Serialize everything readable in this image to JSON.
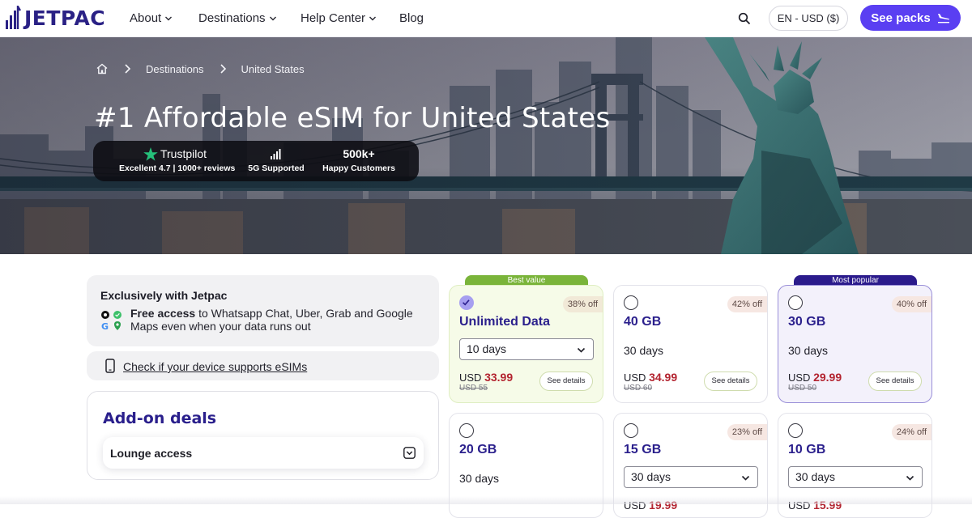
{
  "nav": {
    "logo_text": "JETPAC",
    "items": [
      {
        "label": "About",
        "has_menu": true
      },
      {
        "label": "Destinations",
        "has_menu": true
      },
      {
        "label": "Help Center",
        "has_menu": true
      },
      {
        "label": "Blog",
        "has_menu": false
      }
    ],
    "search_icon": "search-icon",
    "language_label": "EN - USD ($)",
    "cta_label": "See packs",
    "cta_icon": "plane-landing-icon",
    "accent_color": "#5a3ff2",
    "brand_color": "#2a2185"
  },
  "breadcrumb": {
    "home_icon": "home-icon",
    "items": [
      "Destinations",
      "United States"
    ]
  },
  "hero": {
    "title": "#1 Affordable eSIM for United States",
    "stats": [
      {
        "top": "Trustpilot",
        "icon": "trustpilot-star-icon",
        "bottom": "Excellent 4.7 | 1000+ reviews"
      },
      {
        "top": "",
        "icon": "signal-bars-icon",
        "bottom": "5G Supported"
      },
      {
        "top": "500k+",
        "icon": "",
        "bottom": "Happy Customers"
      }
    ]
  },
  "exclusive": {
    "title": "Exclusively with Jetpac",
    "bold": "Free access",
    "text": " to Whatsapp Chat, Uber, Grab and Google Maps even when your data runs out"
  },
  "device_check": {
    "label": "Check if your device supports eSIMs",
    "icon": "phone-icon"
  },
  "addons": {
    "title": "Add-on deals",
    "items": [
      {
        "label": "Lounge access",
        "icon": "chevron-down-square-icon"
      }
    ]
  },
  "packs": [
    {
      "ribbon": "Best value",
      "checked": true,
      "discount": "38% off",
      "title": "Unlimited Data",
      "duration": "10 days",
      "duration_is_select": true,
      "currency": "USD",
      "price": "33.99",
      "old_price": "USD 55",
      "details_label": "See details"
    },
    {
      "ribbon": "",
      "checked": false,
      "discount": "42% off",
      "title": "40 GB",
      "duration": "30 days",
      "duration_is_select": false,
      "currency": "USD",
      "price": "34.99",
      "old_price": "USD 60",
      "details_label": "See details"
    },
    {
      "ribbon": "Most popular",
      "checked": false,
      "discount": "40% off",
      "title": "30 GB",
      "duration": "30 days",
      "duration_is_select": false,
      "currency": "USD",
      "price": "29.99",
      "old_price": "USD 50",
      "details_label": "See details"
    },
    {
      "ribbon": "",
      "checked": false,
      "discount": "",
      "title": "20 GB",
      "duration": "30 days",
      "duration_is_select": false,
      "currency": "",
      "price": "",
      "old_price": "",
      "details_label": ""
    },
    {
      "ribbon": "",
      "checked": false,
      "discount": "23% off",
      "title": "15 GB",
      "duration": "30 days",
      "duration_is_select": true,
      "currency": "USD",
      "price": "19.99",
      "old_price": "",
      "details_label": ""
    },
    {
      "ribbon": "",
      "checked": false,
      "discount": "24% off",
      "title": "10 GB",
      "duration": "30 days",
      "duration_is_select": true,
      "currency": "USD",
      "price": "15.99",
      "old_price": "",
      "details_label": ""
    }
  ],
  "colors": {
    "price_red": "#b3232f",
    "pack_title": "#2a1f8c",
    "best_value_green": "#7ab43a",
    "popular_navy": "#2b1b8c"
  }
}
